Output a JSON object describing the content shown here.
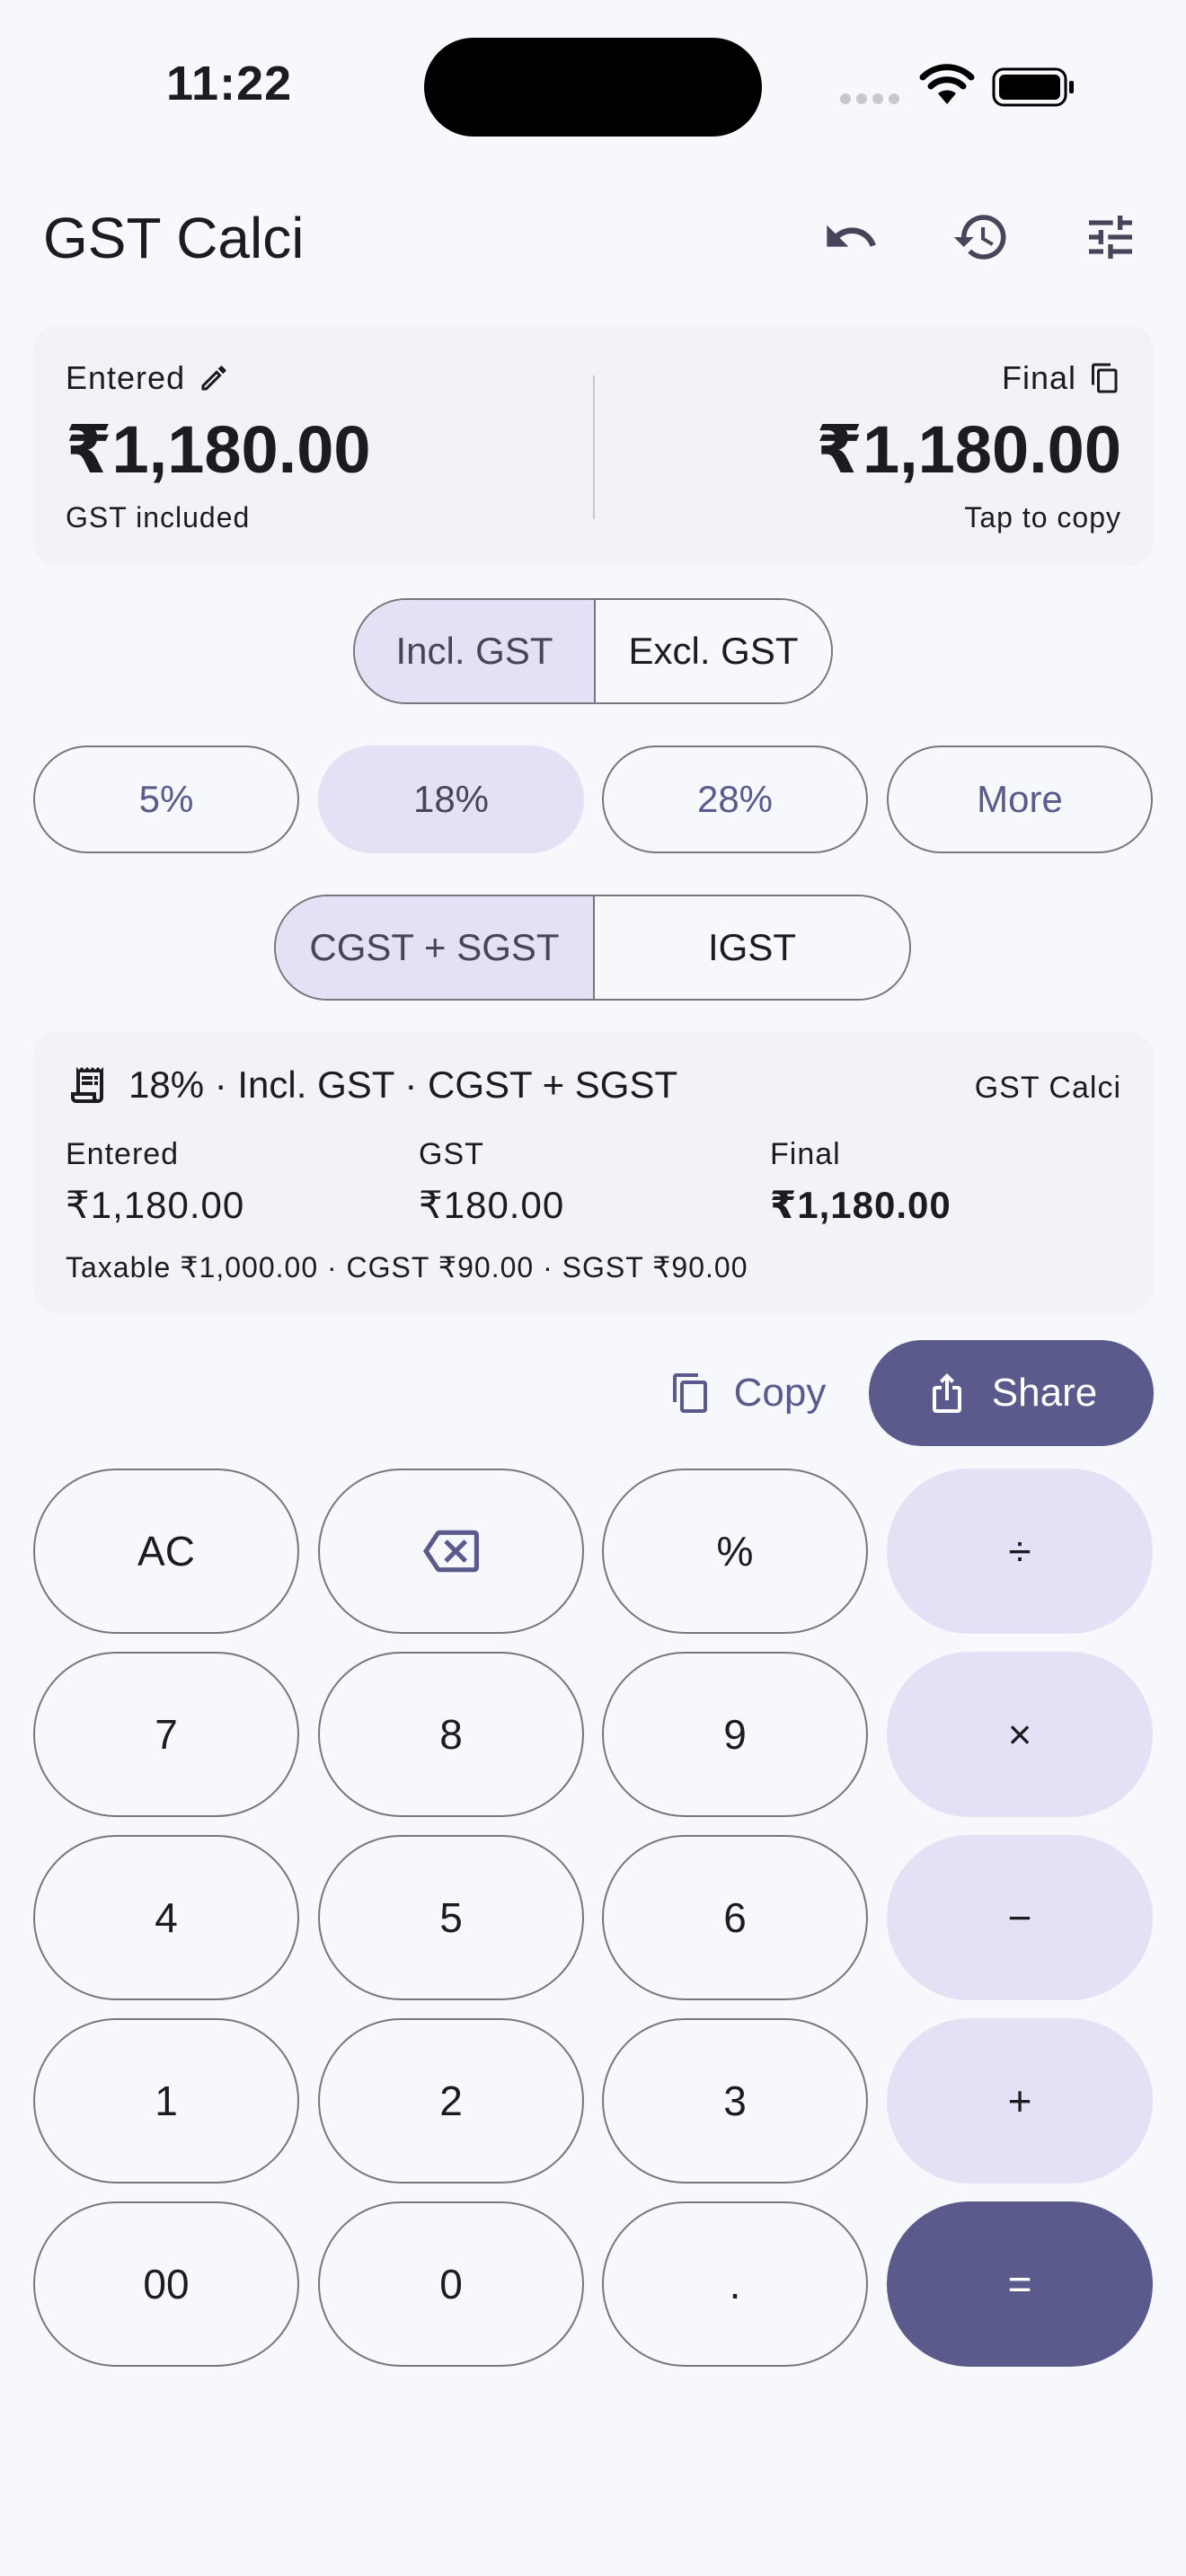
{
  "status": {
    "time": "11:22"
  },
  "app": {
    "title": "GST Calci"
  },
  "toolbar": {
    "icons": [
      "undo-icon",
      "history-icon",
      "tune-icon"
    ]
  },
  "amount": {
    "entered_label": "Entered",
    "entered_value": "₹1,180.00",
    "entered_note": "GST included",
    "final_label": "Final",
    "final_value": "₹1,180.00",
    "final_note": "Tap to copy"
  },
  "mode_toggle": {
    "options": [
      "Incl. GST",
      "Excl. GST"
    ],
    "selected": "Incl. GST"
  },
  "rates": {
    "options": [
      "5%",
      "18%",
      "28%",
      "More"
    ],
    "selected": "18%"
  },
  "tax_type": {
    "options": [
      "CGST + SGST",
      "IGST"
    ],
    "selected": "CGST + SGST"
  },
  "summary": {
    "heading": "18% · Incl. GST · CGST + SGST",
    "brand": "GST Calci",
    "entered_label": "Entered",
    "entered_value": "₹1,180.00",
    "gst_label": "GST",
    "gst_value": "₹180.00",
    "final_label": "Final",
    "final_value": "₹1,180.00",
    "breakdown": "Taxable ₹1,000.00 · CGST ₹90.00 · SGST ₹90.00"
  },
  "actions": {
    "copy_label": "Copy",
    "share_label": "Share"
  },
  "keypad": {
    "keys": [
      [
        "AC",
        "⌫",
        "%",
        "÷"
      ],
      [
        "7",
        "8",
        "9",
        "×"
      ],
      [
        "4",
        "5",
        "6",
        "−"
      ],
      [
        "1",
        "2",
        "3",
        "+"
      ],
      [
        "00",
        "0",
        ".",
        "="
      ]
    ]
  },
  "colors": {
    "background": "#f7f8fc",
    "card": "#f3f2f9",
    "selected": "#e3e1f6",
    "accent": "#5b5a8d",
    "outline": "#77767f"
  }
}
